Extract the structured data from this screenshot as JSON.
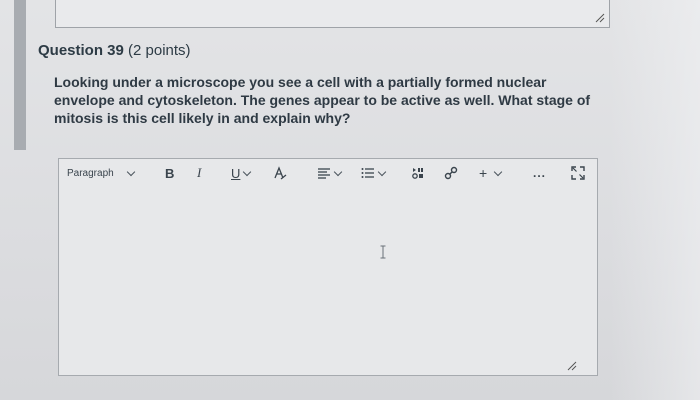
{
  "question": {
    "title": "Question 39",
    "points": " (2 points)",
    "text": "Looking under a microscope you see a cell with a partially formed nuclear envelope and cytoskeleton. The genes appear to be active as well. What stage of mitosis is this cell likely in and explain why?"
  },
  "toolbar": {
    "block_format": "Paragraph",
    "bold": "B",
    "italic": "I",
    "underline": "U",
    "insert": "+",
    "more": "..."
  },
  "icons": {
    "font_color": "font-color-icon",
    "align": "align-icon",
    "list": "list-icon",
    "media": "media-icon",
    "link": "link-icon",
    "fullscreen": "fullscreen-icon",
    "resize": "resize-grip-icon",
    "text_cursor": "text-cursor-icon"
  },
  "colors": {
    "text": "#2d3b45",
    "border": "#a6aaaf",
    "background": "#e3e4e6"
  }
}
